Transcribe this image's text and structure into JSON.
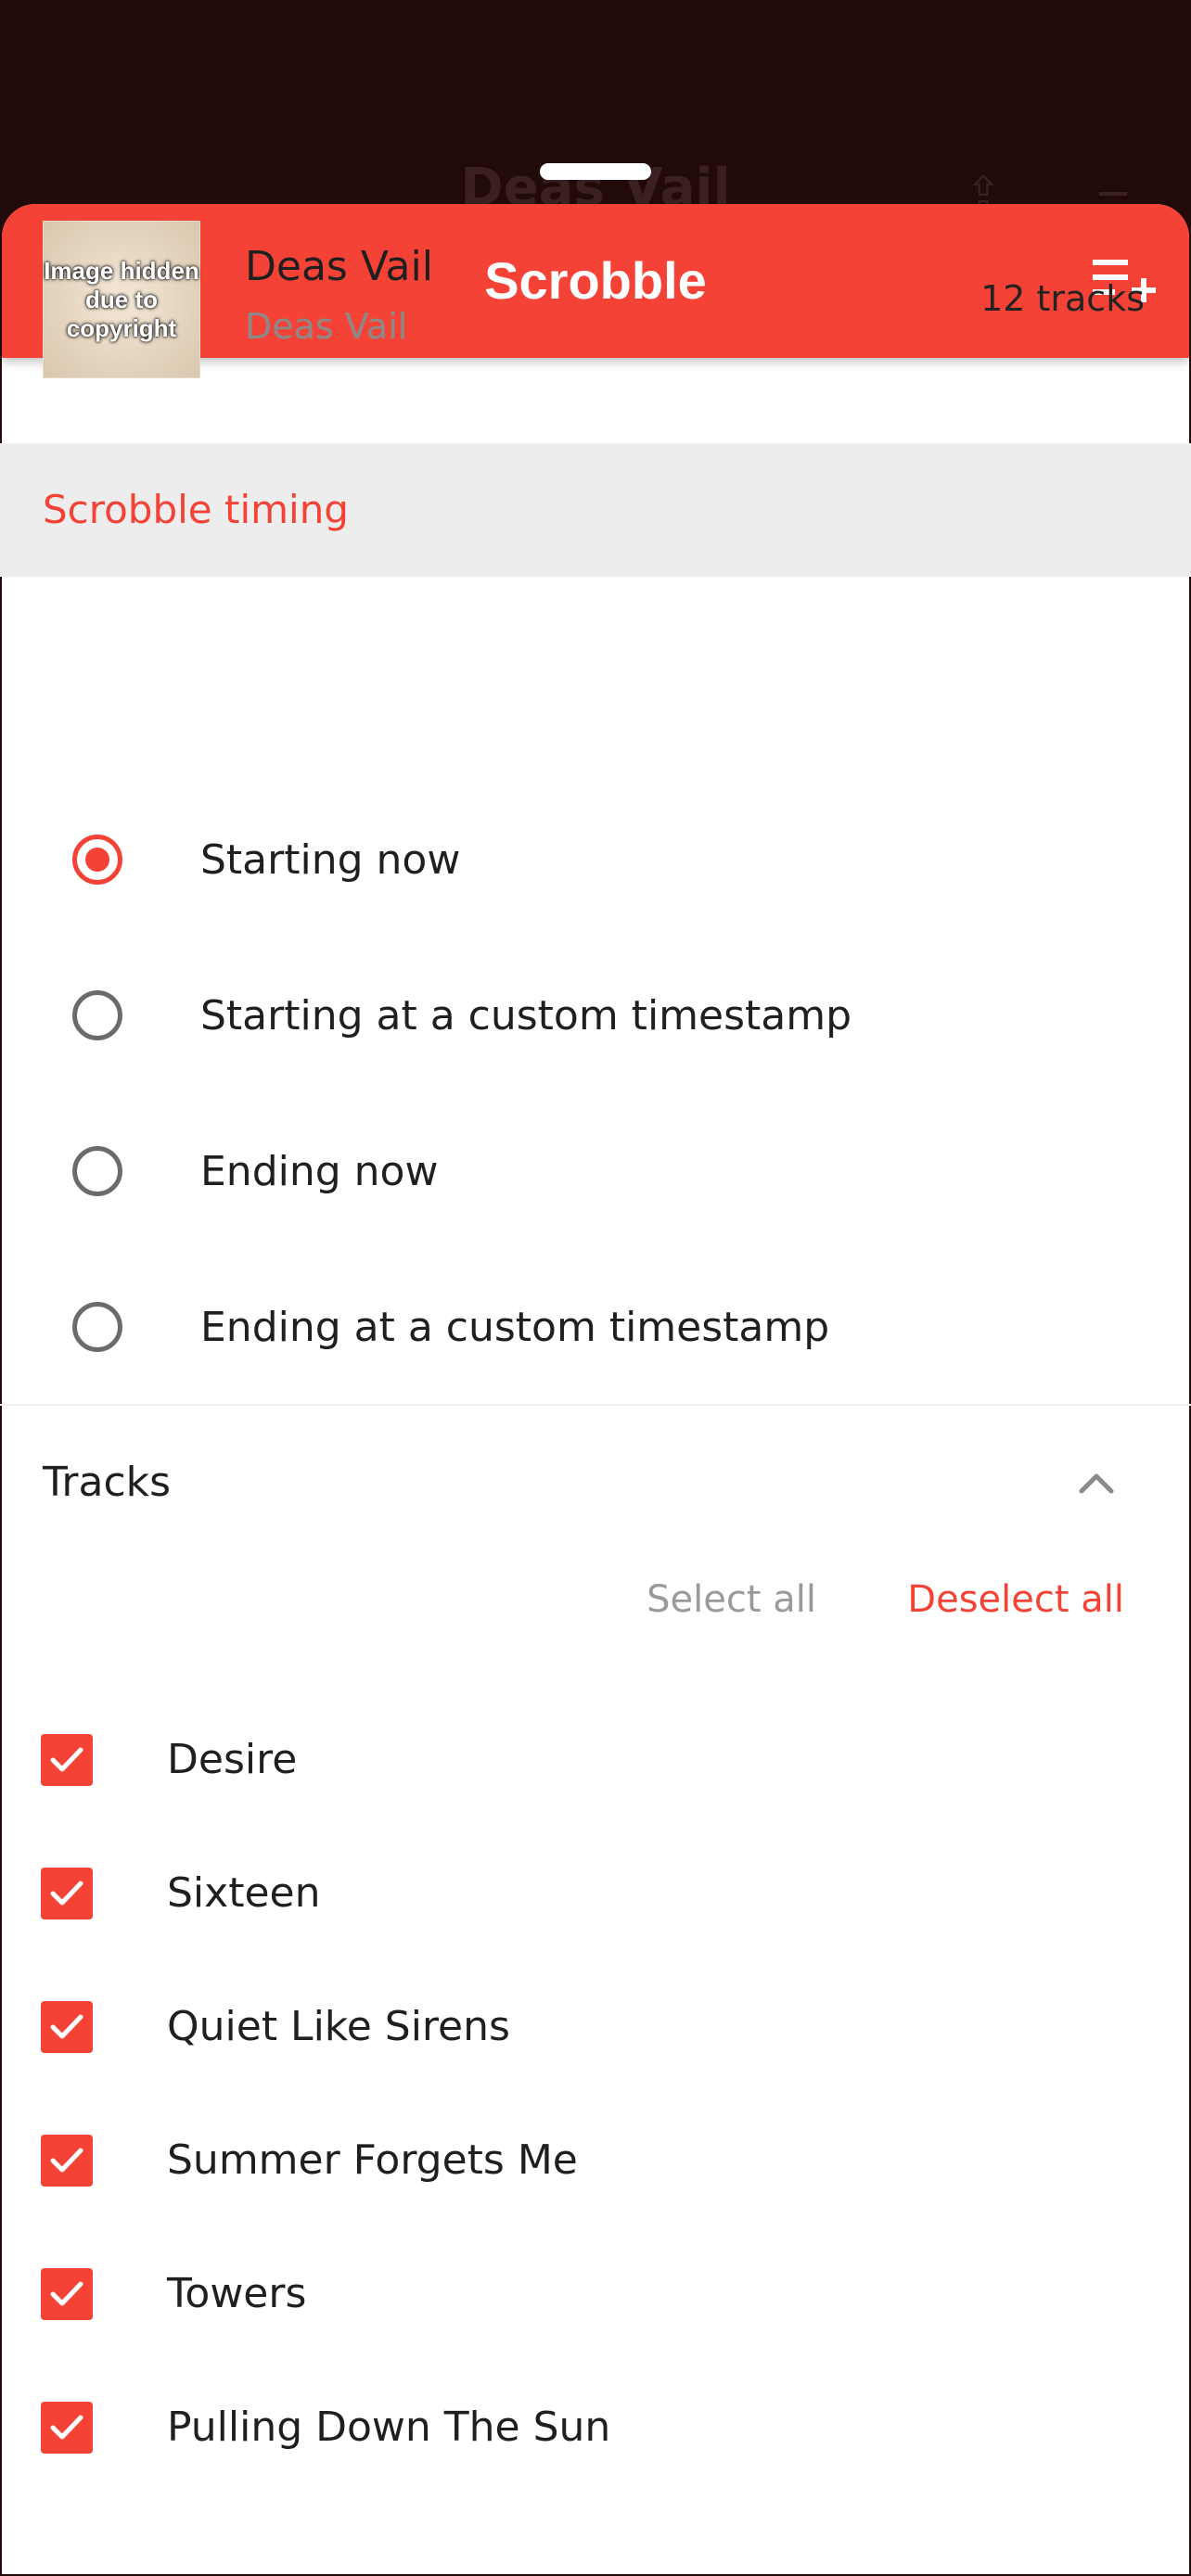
{
  "background": {
    "title": "Deas Vail"
  },
  "app_bar": {
    "title": "Scrobble",
    "back_icon": "chevron-left-icon",
    "queue_icon": "playlist-add-icon"
  },
  "album": {
    "cover_text": "Image hidden due to copyright",
    "title": "Deas Vail",
    "artist": "Deas Vail",
    "track_count": "12 tracks"
  },
  "timing": {
    "header": "Scrobble timing",
    "options": [
      {
        "label": "Starting now",
        "selected": true
      },
      {
        "label": "Starting at a custom timestamp",
        "selected": false
      },
      {
        "label": "Ending now",
        "selected": false
      },
      {
        "label": "Ending at a custom timestamp",
        "selected": false
      }
    ]
  },
  "tracks": {
    "header": "Tracks",
    "select_all": "Select all",
    "deselect_all": "Deselect all",
    "items": [
      {
        "title": "Desire",
        "checked": true
      },
      {
        "title": "Sixteen",
        "checked": true
      },
      {
        "title": "Quiet Like Sirens",
        "checked": true
      },
      {
        "title": "Summer Forgets Me",
        "checked": true
      },
      {
        "title": "Towers",
        "checked": true
      },
      {
        "title": "Pulling Down The Sun",
        "checked": true
      }
    ]
  },
  "colors": {
    "accent": "#f44336",
    "band": "#ededed",
    "backdrop": "#220a0a"
  }
}
